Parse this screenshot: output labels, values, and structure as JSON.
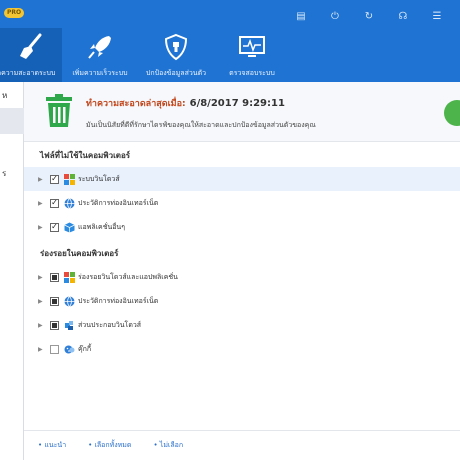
{
  "app": {
    "pro_badge": "PRO"
  },
  "window_controls": [
    {
      "icon": "feedback-icon",
      "glyph": "▤"
    },
    {
      "icon": "power-icon",
      "glyph": "⏻"
    },
    {
      "icon": "refresh-icon",
      "glyph": "↻"
    },
    {
      "icon": "headset-icon",
      "glyph": "☊"
    },
    {
      "icon": "menu-icon",
      "glyph": "☰"
    }
  ],
  "nav": [
    {
      "label": "ทำความสะอาดระบบ",
      "icon": "broom-icon"
    },
    {
      "label": "เพิ่มความเร็วระบบ",
      "icon": "rocket-icon"
    },
    {
      "label": "ปกป้องข้อมูลส่วนตัว",
      "icon": "shield-icon"
    },
    {
      "label": "ตรวจสอบระบบ",
      "icon": "monitor-icon"
    }
  ],
  "sidebar": {
    "items": [
      "ห",
      "",
      "",
      "ร"
    ]
  },
  "summary": {
    "last_clean_label": "ทำความสะอาดล่าสุดเมื่อ:",
    "last_clean_value": "6/8/2017 9:29:11",
    "description": "มันเป็นนิสัยที่ดีที่รักษาไดรฟ์ของคุณให้สะอาดและปกป้องข้อมูลส่วนตัวของคุณ"
  },
  "sections": [
    {
      "title": "ไฟล์ที่ไม่ใช้ในคอมพิวเตอร์",
      "items": [
        {
          "label": "ระบบวินโดวส์",
          "state": "checked",
          "icon": "windows-icon"
        },
        {
          "label": "ประวัติการท่องอินเทอร์เน็ต",
          "state": "checked",
          "icon": "globe-icon"
        },
        {
          "label": "แอพลิเคชั่นอื่นๆ",
          "state": "checked",
          "icon": "app-box-icon"
        }
      ]
    },
    {
      "title": "ร่องรอยในคอมพิวเตอร์",
      "items": [
        {
          "label": "ร่องรอยวินโดวส์และแอปพลิเคชั่น",
          "state": "partial",
          "icon": "windows-icon"
        },
        {
          "label": "ประวัติการท่องอินเทอร์เน็ต",
          "state": "partial",
          "icon": "globe-icon"
        },
        {
          "label": "ส่วนประกอบวินโดวส์",
          "state": "partial",
          "icon": "puzzle-icon"
        },
        {
          "label": "คุ๊กกี้",
          "state": "unchecked",
          "icon": "cookie-icon"
        }
      ]
    }
  ],
  "footer": {
    "links": [
      "แนะนำ",
      "เลือกทั้งหมด",
      "ไม่เลือก"
    ]
  },
  "colors": {
    "header": "#1f73d2",
    "accent_title": "#c2471d",
    "trash_green": "#2ea84b",
    "link": "#2a6fc9"
  }
}
